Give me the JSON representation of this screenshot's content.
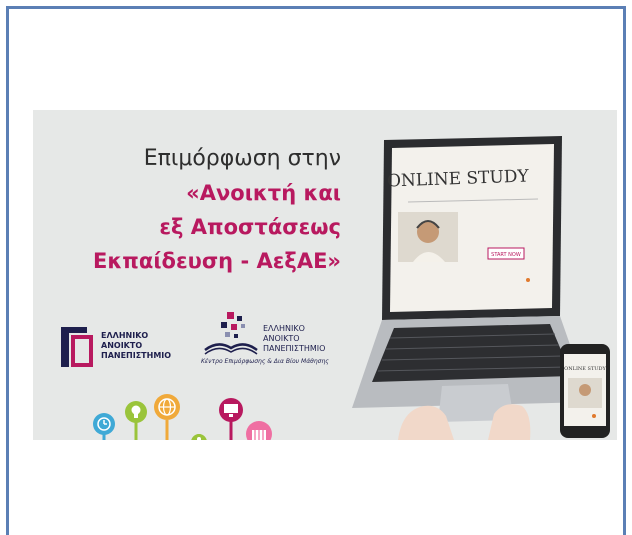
{
  "banner": {
    "line1": "Επιμόρφωση στην",
    "line2": "«Ανοικτή και",
    "line3": "εξ Αποστάσεως",
    "line4": "Εκπαίδευση - ΑεξΑΕ»",
    "screen_title": "ONLINE STUDY",
    "screen_button": "START NOW",
    "phone_text": "ONLINE STUDY",
    "colors": {
      "accent": "#b8195f",
      "frame": "#5b7fb5",
      "navy": "#1e1f4d",
      "background": "#e6e8e7"
    }
  },
  "logos": {
    "eap_line1": "ΕΛΛΗΝΙΚΟ",
    "eap_line2": "ΑΝΟΙΚΤΟ",
    "eap_line3": "ΠΑΝΕΠΙΣΤΗΜΙΟ",
    "kedivim_line1": "ΕΛΛΗΝΙΚΟ",
    "kedivim_line2": "ΑΝΟΙΚΤΟ",
    "kedivim_line3": "ΠΑΝΕΠΙΣΤΗΜΙΟ",
    "kedivim_sub": "Κέντρο Επιμόρφωσης & Δια Βίου Μάθησης"
  }
}
